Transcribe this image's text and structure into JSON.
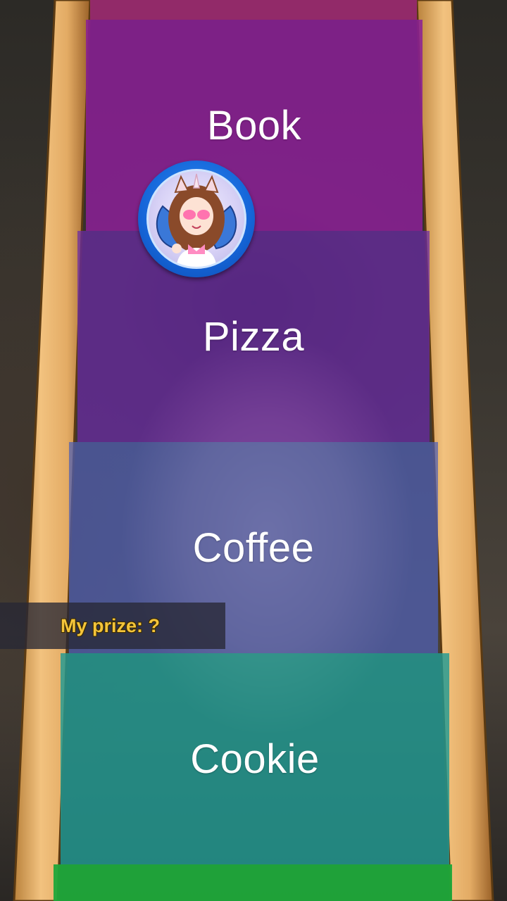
{
  "wheel": {
    "segments": [
      {
        "label": "",
        "color": "#9b2a6f"
      },
      {
        "label": "Book",
        "color": "#8a1f96"
      },
      {
        "label": "Pizza",
        "color": "#6a2aa8"
      },
      {
        "label": "Coffee",
        "color": "#4f5fb6"
      },
      {
        "label": "Cookie",
        "color": "#219a92"
      },
      {
        "label": "",
        "color": "#1fa83a"
      }
    ],
    "frame_color": "#e6b36f"
  },
  "avatar": {
    "icon": "anime-girl-avatar-icon"
  },
  "prize": {
    "label": "My prize: ?"
  }
}
